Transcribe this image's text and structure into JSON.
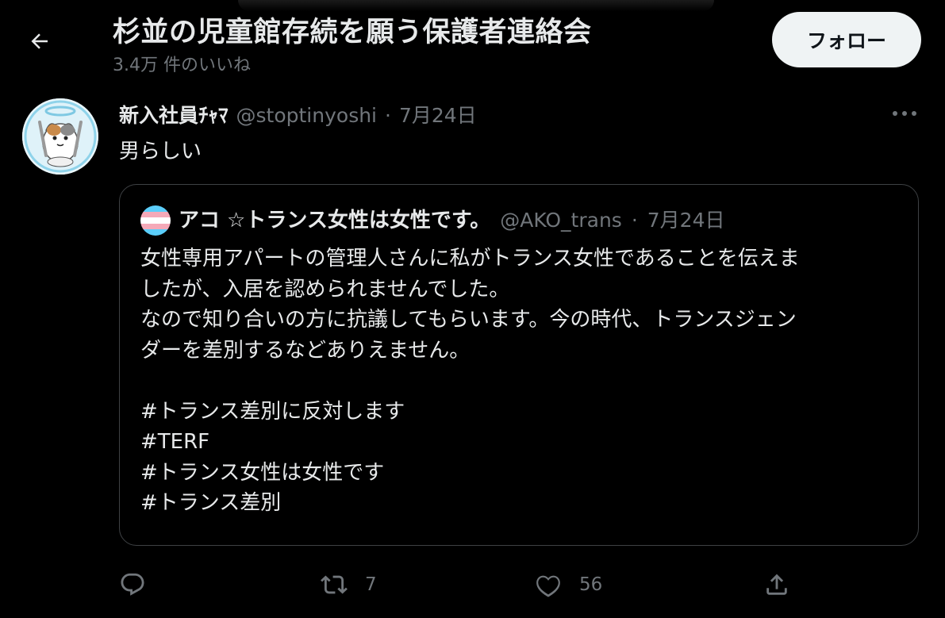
{
  "header": {
    "title": "杉並の児童館存続を願う保護者連絡会",
    "likes_label": "3.4万 件のいいね",
    "follow_label": "フォロー"
  },
  "tweet": {
    "display_name": "新入社員ﾁｬﾏ",
    "handle": "@stoptinyoshi",
    "separator": "·",
    "date": "7月24日",
    "text": "男らしい",
    "avatar_icon": "cat-angel-avatar"
  },
  "quote": {
    "avatar_icon": "trans-flag-avatar",
    "display_name": "アコ ☆トランス女性は女性です。",
    "handle": "@AKO_trans",
    "separator": "·",
    "date": "7月24日",
    "lines": [
      "女性専用アパートの管理人さんに私がトランス女性であることを伝えま",
      "したが、入居を認められませんでした。",
      "なので知り合いの方に抗議してもらいます。今の時代、トランスジェン",
      "ダーを差別するなどありえません。"
    ],
    "hashtags": [
      "#トランス差別に反対します",
      "#TERF",
      "#トランス女性は女性です",
      "#トランス差別"
    ]
  },
  "actions": {
    "reply_count": "",
    "retweet_count": "7",
    "like_count": "56",
    "share_count": ""
  },
  "colors": {
    "background": "#000000",
    "text": "#e7e9ea",
    "muted": "#71767b",
    "border": "#3e4144",
    "follow_bg": "#eff3f4",
    "trans_blue": "#5bcefa",
    "trans_pink": "#f5a9b8"
  }
}
